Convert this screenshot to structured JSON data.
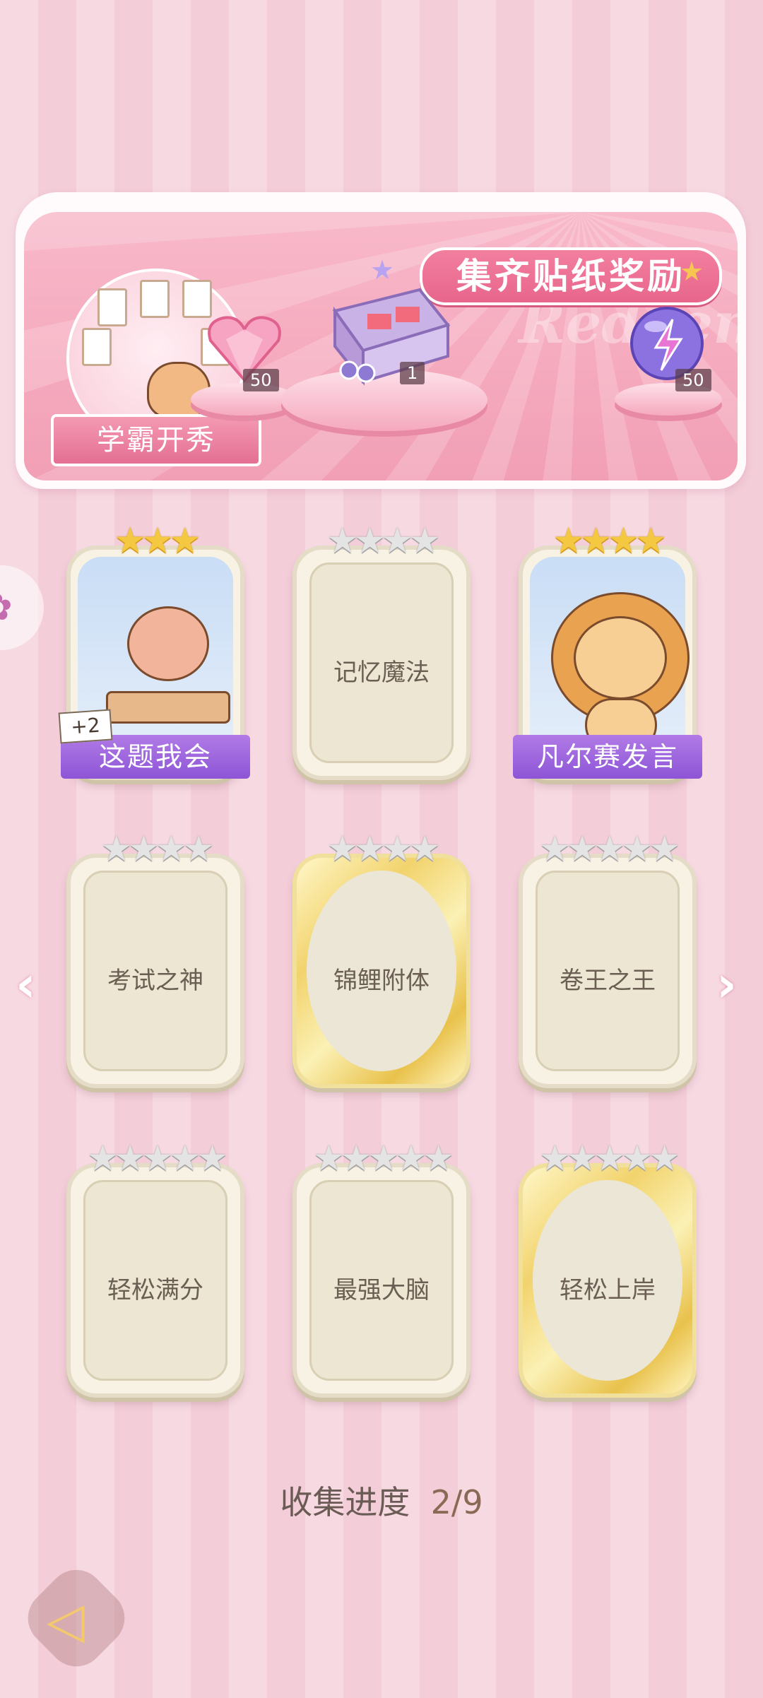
{
  "banner": {
    "title": "集齐贴纸奖励",
    "watermark": "Redeem",
    "theme_label": "学霸开秀",
    "rewards": [
      {
        "icon": "pink-heart-gem-icon",
        "count": "50"
      },
      {
        "icon": "gift-box-icon",
        "count": "1"
      },
      {
        "icon": "lightning-orb-icon",
        "count": "50"
      }
    ]
  },
  "cards": [
    {
      "label": "这题我会",
      "stars_earned": 3,
      "stars_total": 3,
      "collected": true,
      "tag": "+2",
      "character": "bear-at-desk"
    },
    {
      "label": "记忆魔法",
      "stars_earned": 0,
      "stars_total": 4,
      "collected": false
    },
    {
      "label": "凡尔赛发言",
      "stars_earned": 4,
      "stars_total": 4,
      "collected": true,
      "character": "lion-with-microphone"
    },
    {
      "label": "考试之神",
      "stars_earned": 0,
      "stars_total": 4,
      "collected": false
    },
    {
      "label": "锦鲤附体",
      "stars_earned": 0,
      "stars_total": 4,
      "collected": false,
      "rare": true
    },
    {
      "label": "卷王之王",
      "stars_earned": 0,
      "stars_total": 5,
      "collected": false
    },
    {
      "label": "轻松满分",
      "stars_earned": 0,
      "stars_total": 5,
      "collected": false
    },
    {
      "label": "最强大脑",
      "stars_earned": 0,
      "stars_total": 5,
      "collected": false
    },
    {
      "label": "轻松上岸",
      "stars_earned": 0,
      "stars_total": 5,
      "collected": false,
      "rare": true
    }
  ],
  "progress": {
    "label": "收集进度",
    "value": "2/9"
  },
  "colors": {
    "accent_pink": "#e8668c",
    "card_banner_purple": "#8d55d6",
    "star_gold": "#f5c842"
  }
}
